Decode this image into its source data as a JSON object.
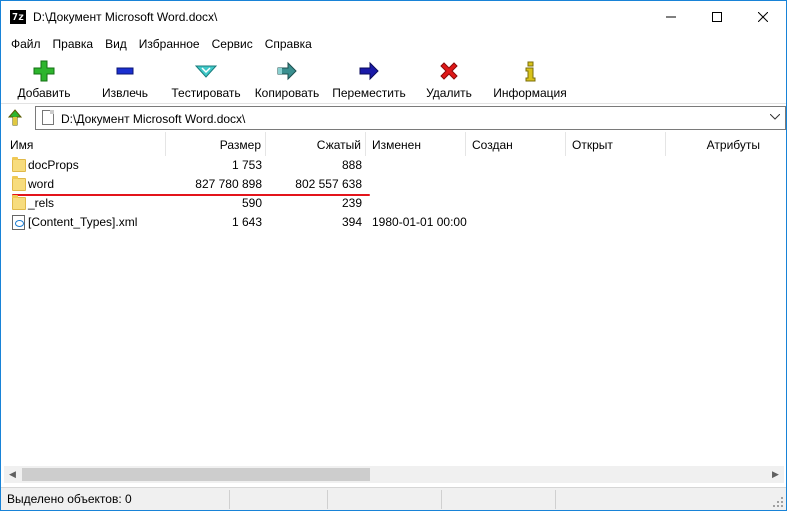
{
  "window": {
    "title": "D:\\Документ Microsoft Word.docx\\",
    "app_icon_text": "7z"
  },
  "menu": [
    "Файл",
    "Правка",
    "Вид",
    "Избранное",
    "Сервис",
    "Справка"
  ],
  "toolbar": {
    "add": "Добавить",
    "extract": "Извлечь",
    "test": "Тестировать",
    "copy": "Копировать",
    "move": "Переместить",
    "delete": "Удалить",
    "info": "Информация"
  },
  "address": {
    "path": "D:\\Документ Microsoft Word.docx\\"
  },
  "columns": {
    "name": "Имя",
    "size": "Размер",
    "packed": "Сжатый",
    "modified": "Изменен",
    "created": "Создан",
    "accessed": "Открыт",
    "attributes": "Атрибуты"
  },
  "files": [
    {
      "name": "docProps",
      "size": "1 753",
      "packed": "888",
      "modified": ""
    },
    {
      "name": "word",
      "size": "827 780 898",
      "packed": "802 557 638",
      "modified": ""
    },
    {
      "name": "_rels",
      "size": "590",
      "packed": "239",
      "modified": ""
    },
    {
      "name": "[Content_Types].xml",
      "size": "1 643",
      "packed": "394",
      "modified": "1980-01-01 00:00"
    }
  ],
  "status": {
    "selected": "Выделено объектов: 0"
  },
  "colors": {
    "add_icon": "#2db52d",
    "extract_icon": "#1a2fd0",
    "test_icon": "#3fc8c8",
    "copy_icon": "#3a8f8f",
    "move_icon": "#1a1aa8",
    "delete_icon": "#e01818",
    "info_icon": "#d8c21a",
    "annotation_underline": "#e3141b"
  }
}
